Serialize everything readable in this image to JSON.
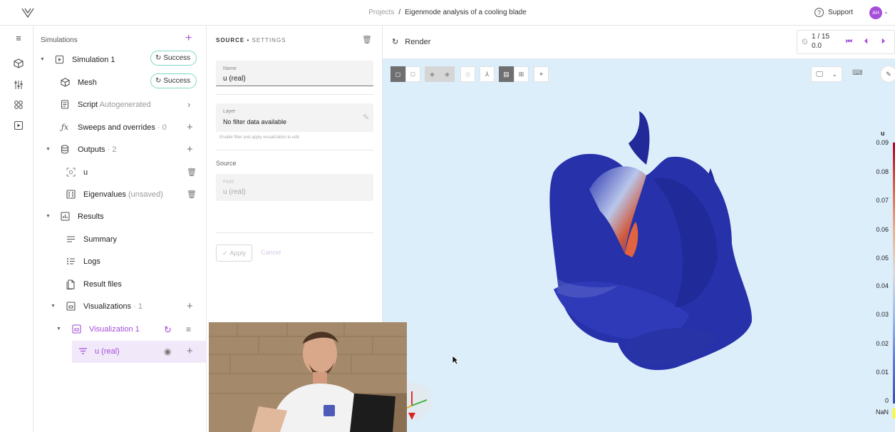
{
  "header": {
    "breadcrumb_projects": "Projects",
    "breadcrumb_sep": "/",
    "breadcrumb_current": "Eigenmode analysis of a cooling blade",
    "support_label": "Support",
    "avatar_initials": "AH"
  },
  "rail": {
    "icons": [
      "menu-icon",
      "cube-icon",
      "sliders-icon",
      "apps-icon",
      "play-icon"
    ]
  },
  "tree": {
    "heading": "Simulations",
    "simulation": {
      "label": "Simulation 1",
      "status": "Success"
    },
    "mesh": {
      "label": "Mesh",
      "status": "Success"
    },
    "script": {
      "label": "Script",
      "note": "Autogenerated"
    },
    "sweeps": {
      "label": "Sweeps and overrides",
      "count": "· 0"
    },
    "outputs": {
      "label": "Outputs",
      "count": "· 2"
    },
    "output_u": {
      "label": "u"
    },
    "eigenvalues": {
      "label": "Eigenvalues",
      "note": "(unsaved)"
    },
    "results": {
      "label": "Results"
    },
    "summary": {
      "label": "Summary"
    },
    "logs": {
      "label": "Logs"
    },
    "result_files": {
      "label": "Result files"
    },
    "visualizations": {
      "label": "Visualizations",
      "count": "· 1"
    },
    "visualization1": {
      "label": "Visualization 1"
    },
    "layer_u": {
      "label": "u (real)"
    }
  },
  "settings": {
    "title_source": "SOURCE",
    "title_dot": "•",
    "title_settings": "SETTINGS",
    "name_label": "Name",
    "name_value": "u (real)",
    "layer_label": "Layer",
    "layer_value": "No filter data available",
    "layer_hint": "Enable filter and apply visualization to edit",
    "source_heading": "Source",
    "field_label": "Field",
    "field_value": "u (real)",
    "apply_label": "Apply",
    "cancel_label": "Cancel"
  },
  "viewer": {
    "render_label": "Render",
    "frame_top": "1 / 15",
    "frame_bottom": "0.0",
    "legend": {
      "title": "u",
      "ticks": [
        "0.09",
        "0.08",
        "0.07",
        "0.06",
        "0.05",
        "0.04",
        "0.03",
        "0.02",
        "0.01",
        "0"
      ],
      "nan_label": "NaN",
      "colors": {
        "high": "#b40426",
        "mid": "#dcdddd",
        "low": "#3b4cc0",
        "nan": "#ffff00"
      }
    },
    "toolbar_icons": [
      "solid-view-icon",
      "wireframe-icon",
      "hide-icon",
      "show-icon",
      "eye-off-icon",
      "axes-icon",
      "panel-icon",
      "grid-icon",
      "focus-icon"
    ]
  },
  "colors": {
    "accent": "#a64dd9",
    "success_border": "#7ed6c4",
    "viewer_bg": "#ddeefb",
    "mesh_blue": "#2a35b0"
  }
}
